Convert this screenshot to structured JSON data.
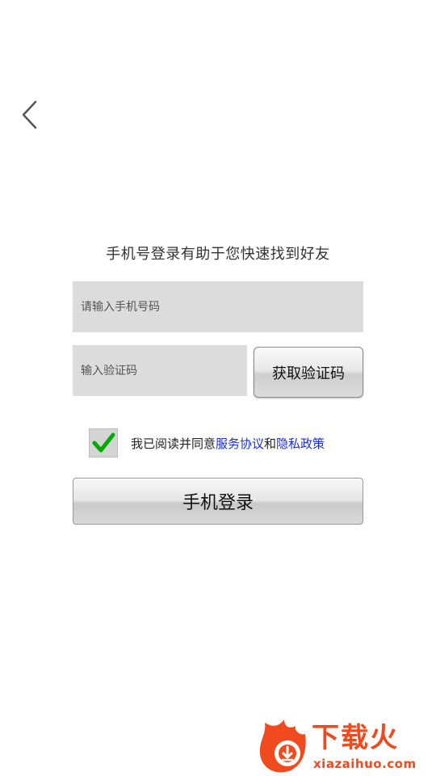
{
  "header": {
    "back_icon": "chevron-left-icon"
  },
  "headline": "手机号登录有助于您快速找到好友",
  "form": {
    "phone_placeholder": "请输入手机号码",
    "phone_value": "",
    "code_placeholder": "输入验证码",
    "code_value": "",
    "get_code_label": "获取验证码"
  },
  "agreement": {
    "checked": true,
    "check_icon": "checkmark-icon",
    "prefix": "我已阅读并同意",
    "terms_link": "服务协议",
    "conjunction": "和",
    "privacy_link": "隐私政策",
    "link_color": "#1a2ee0"
  },
  "login_label": "手机登录",
  "watermark": {
    "title": "下载火",
    "subtitle": "xiazaihuo.com",
    "color": "#f04a1e",
    "logo_icon": "flame-download-icon"
  }
}
